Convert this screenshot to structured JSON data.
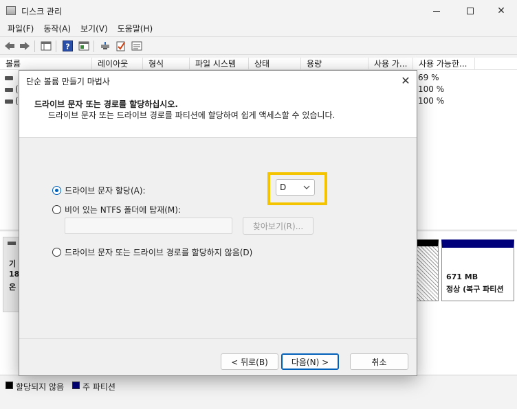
{
  "window": {
    "title": "디스크 관리",
    "minimize": "minimize",
    "maximize": "maximize",
    "close": "✕"
  },
  "menu": [
    "파일(F)",
    "동작(A)",
    "보기(V)",
    "도움말(H)"
  ],
  "toolbar_icons": [
    "back-arrow-icon",
    "forward-arrow-icon",
    "properties-grid-icon",
    "help-icon",
    "console-pane-icon",
    "connect-drive-icon",
    "check-document-icon",
    "list-view-icon"
  ],
  "columns": [
    "볼륨",
    "레이아웃",
    "형식",
    "파일 시스템",
    "상태",
    "용량",
    "사용 가...",
    "사용 가능한..."
  ],
  "volumes": [
    {
      "prefix": "",
      "percent": "69 %"
    },
    {
      "prefix": "(",
      "percent": "100 %"
    },
    {
      "prefix": "(",
      "percent": "100 %"
    }
  ],
  "disk": {
    "label_lines": [
      "기",
      "18",
      "온"
    ],
    "partition": {
      "size": "671 MB",
      "status": "정상 (복구 파티션"
    }
  },
  "legend": [
    {
      "label": "할당되지 않음",
      "color": "#000000"
    },
    {
      "label": "주 파티션",
      "color": "#00007a"
    }
  ],
  "dialog": {
    "title": "단순 볼륨 만들기 마법사",
    "heading": "드라이브 문자 또는 경로를 할당하십시오.",
    "subheading": "드라이브 문자 또는 드라이브 경로를 파티션에 할당하여 쉽게 액세스할 수 있습니다.",
    "options": {
      "assign_letter": "드라이브 문자 할당(A):",
      "mount_folder": "비어 있는 NTFS 폴더에 탑재(M):",
      "no_assign": "드라이브 문자 또는 드라이브 경로를 할당하지 않음(D)"
    },
    "selected_option": "assign_letter",
    "drive_letter": "D",
    "browse": "찾아보기(R)...",
    "buttons": {
      "back": "< 뒤로(B)",
      "next": "다음(N) >",
      "cancel": "취소"
    }
  },
  "colors": {
    "accent": "#005fb8",
    "highlight": "#f5c400",
    "partition": "#00007a"
  }
}
